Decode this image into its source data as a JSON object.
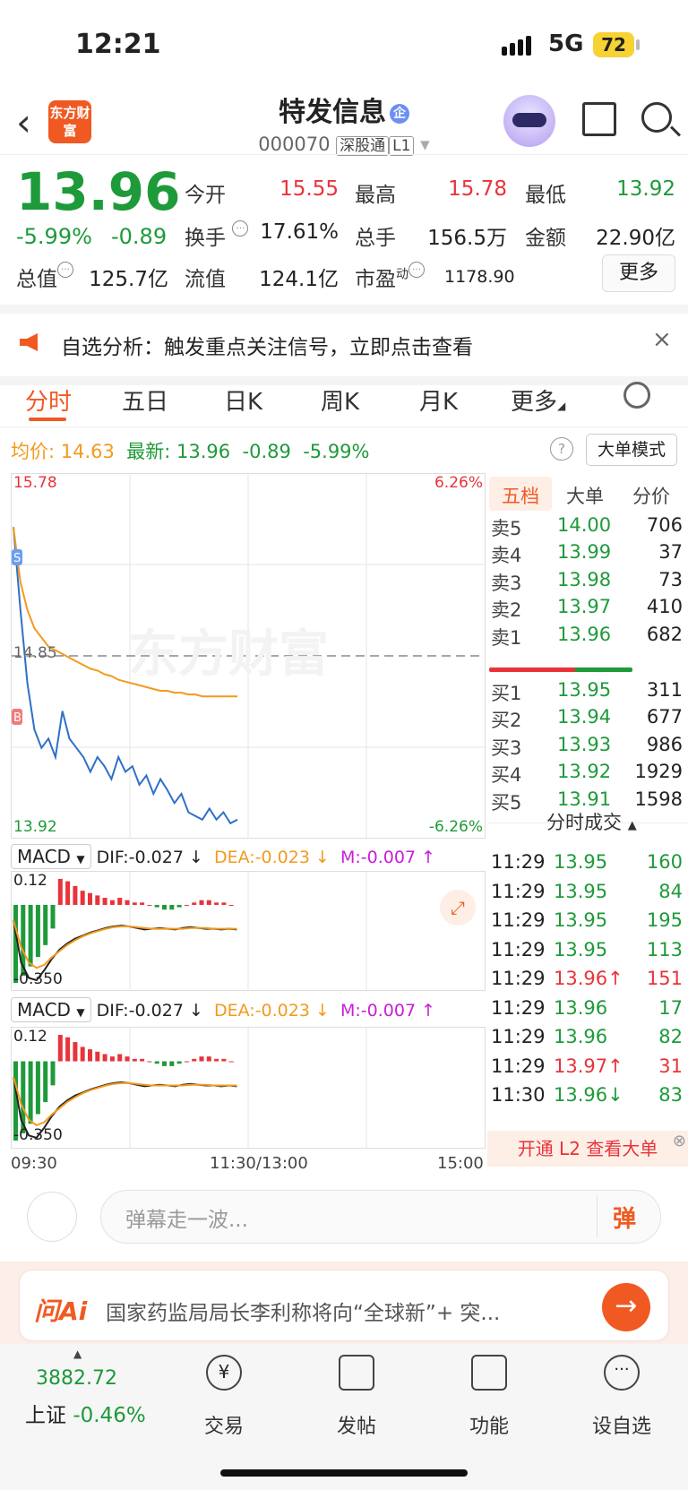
{
  "status": {
    "time": "12:21",
    "network": "5G",
    "battery": "72"
  },
  "nav": {
    "logo_text": "东方财富",
    "title": "特发信息",
    "badge": "企",
    "code": "000070",
    "tag1": "深股通",
    "tag2": "L1"
  },
  "quote": {
    "price": "13.96",
    "pct": "-5.99%",
    "change": "-0.89",
    "open_label": "今开",
    "open": "15.55",
    "high_label": "最高",
    "high": "15.78",
    "low_label": "最低",
    "low": "13.92",
    "turnover_label": "换手",
    "turnover": "17.61%",
    "volume_label": "总手",
    "volume": "156.5万",
    "amount_label": "金额",
    "amount": "22.90亿",
    "mktcap_label": "总值",
    "mktcap": "125.7亿",
    "float_label": "流值",
    "float": "124.1亿",
    "pe_label": "市盈",
    "pe_sup": "动",
    "pe": "1178.90",
    "more": "更多"
  },
  "banner": {
    "text": "自选分析：触发重点关注信号，立即点击查看",
    "close": "×"
  },
  "tabs": [
    "分时",
    "五日",
    "日K",
    "周K",
    "月K",
    "更多"
  ],
  "info": {
    "avg_label": "均价:",
    "avg": "14.63",
    "latest_label": "最新:",
    "latest": "13.96",
    "chg": "-0.89",
    "pct": "-5.99%",
    "mode": "大单模式",
    "help": "?"
  },
  "chart_data": {
    "type": "line",
    "x_axis": [
      "09:30",
      "11:30/13:00",
      "15:00"
    ],
    "y_left_max": "15.78",
    "y_left_mid": "14.85",
    "y_left_min": "13.92",
    "y_right_max": "6.26%",
    "y_right_min": "-6.26%",
    "watermark": "东方财富",
    "series": [
      {
        "color": "#2f6fc9",
        "values": [
          15.55,
          15.1,
          14.7,
          14.45,
          14.35,
          14.4,
          14.3,
          14.55,
          14.4,
          14.35,
          14.3,
          14.22,
          14.3,
          14.25,
          14.18,
          14.3,
          14.22,
          14.25,
          14.15,
          14.2,
          14.1,
          14.18,
          14.12,
          14.05,
          14.1,
          14.0,
          13.98,
          13.96,
          14.02,
          13.96,
          14.0,
          13.94,
          13.96
        ]
      },
      {
        "color": "#f29a1f",
        "values": [
          15.55,
          15.25,
          15.1,
          15.0,
          14.95,
          14.9,
          14.88,
          14.86,
          14.84,
          14.82,
          14.8,
          14.78,
          14.77,
          14.75,
          14.74,
          14.72,
          14.71,
          14.7,
          14.69,
          14.68,
          14.67,
          14.66,
          14.66,
          14.65,
          14.65,
          14.64,
          14.64,
          14.63,
          14.63,
          14.63,
          14.63,
          14.63,
          14.63
        ]
      }
    ],
    "markers": [
      "S",
      "B"
    ],
    "macd": {
      "name": "MACD",
      "dif": "DIF:-0.027 ↓",
      "dea": "DEA:-0.023 ↓",
      "m": "M:-0.007 ↑",
      "top": "0.12",
      "bottom": "-0.350",
      "bars": [
        -0.33,
        -0.3,
        -0.26,
        -0.22,
        -0.17,
        -0.1,
        0.11,
        0.1,
        0.08,
        0.06,
        0.05,
        0.04,
        0.03,
        0.02,
        0.03,
        0.02,
        0.01,
        0.01,
        0.0,
        -0.01,
        -0.02,
        -0.02,
        -0.01,
        0.0,
        0.01,
        0.02,
        0.02,
        0.01,
        0.01,
        0.0
      ]
    }
  },
  "orderbook": {
    "tabs": [
      "五档",
      "大单",
      "分价"
    ],
    "sell": [
      {
        "name": "卖5",
        "price": "14.00",
        "vol": "706"
      },
      {
        "name": "卖4",
        "price": "13.99",
        "vol": "37"
      },
      {
        "name": "卖3",
        "price": "13.98",
        "vol": "73"
      },
      {
        "name": "卖2",
        "price": "13.97",
        "vol": "410"
      },
      {
        "name": "卖1",
        "price": "13.96",
        "vol": "682"
      }
    ],
    "buy": [
      {
        "name": "买1",
        "price": "13.95",
        "vol": "311"
      },
      {
        "name": "买2",
        "price": "13.94",
        "vol": "677"
      },
      {
        "name": "买3",
        "price": "13.93",
        "vol": "986"
      },
      {
        "name": "买4",
        "price": "13.92",
        "vol": "1929"
      },
      {
        "name": "买5",
        "price": "13.91",
        "vol": "1598"
      }
    ],
    "deals_header": "分时成交",
    "deals": [
      {
        "t": "11:29",
        "p": "13.95",
        "v": "160",
        "dir": "green"
      },
      {
        "t": "11:29",
        "p": "13.95",
        "v": "84",
        "dir": "green"
      },
      {
        "t": "11:29",
        "p": "13.95",
        "v": "195",
        "dir": "green"
      },
      {
        "t": "11:29",
        "p": "13.95",
        "v": "113",
        "dir": "green"
      },
      {
        "t": "11:29",
        "p": "13.96↑",
        "v": "151",
        "dir": "red"
      },
      {
        "t": "11:29",
        "p": "13.96",
        "v": "17",
        "dir": "green"
      },
      {
        "t": "11:29",
        "p": "13.96",
        "v": "82",
        "dir": "green"
      },
      {
        "t": "11:29",
        "p": "13.97↑",
        "v": "31",
        "dir": "red"
      },
      {
        "t": "11:30",
        "p": "13.96↓",
        "v": "83",
        "dir": "green"
      }
    ],
    "l2": "开通 L2 查看大单"
  },
  "comment": {
    "placeholder": "弹幕走一波...",
    "dan": "弹"
  },
  "ai": {
    "logo": "问Ai",
    "text": "国家药监局局长李利称将向“全球新”+ 突..."
  },
  "bottom": {
    "index_value": "3882.72",
    "index_name": "上证",
    "index_pct": "-0.46%",
    "items": [
      "交易",
      "发帖",
      "功能",
      "设自选"
    ]
  }
}
